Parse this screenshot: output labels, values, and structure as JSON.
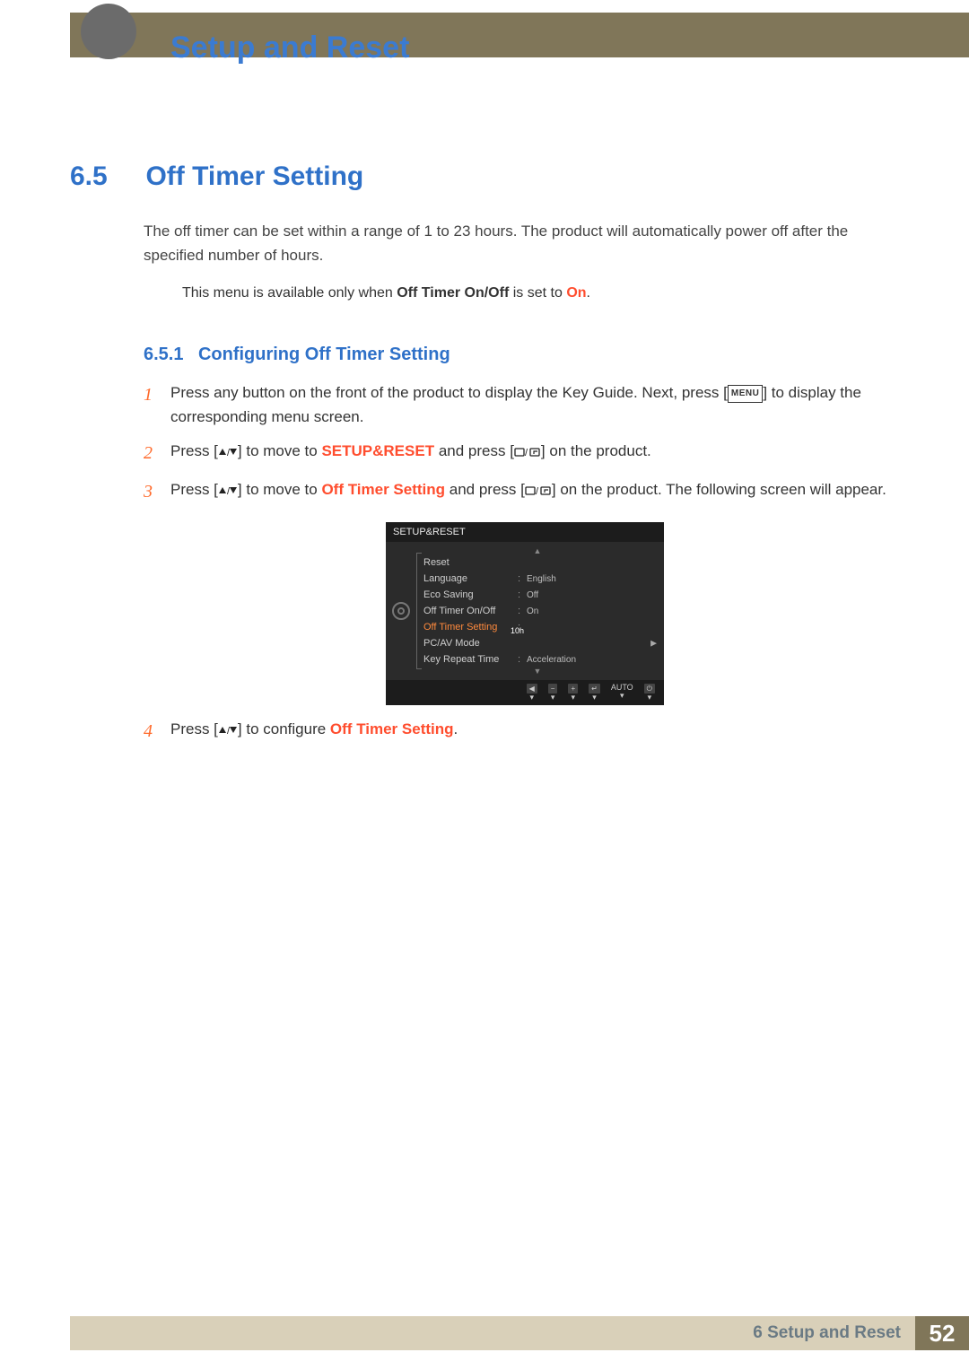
{
  "header": {
    "chapter_title": "Setup and Reset"
  },
  "section": {
    "number": "6.5",
    "title": "Off Timer Setting",
    "body": "The off timer can be set within a range of 1 to 23 hours. The product will automatically power off after the specified number of hours.",
    "note_prefix": "This menu is available only when ",
    "note_bold": "Off Timer On/Off",
    "note_mid": " is set to ",
    "note_on": "On",
    "note_suffix": "."
  },
  "subsection": {
    "number": "6.5.1",
    "title": "Configuring Off Timer Setting"
  },
  "steps": {
    "s1": {
      "num": "1",
      "a": "Press any button on the front of the product to display the Key Guide. Next, press [",
      "menu": "MENU",
      "b": "] to display the corresponding menu screen."
    },
    "s2": {
      "num": "2",
      "a": "Press [",
      "b": "] to move to ",
      "hl": "SETUP&RESET",
      "c": " and press [",
      "d": "] on the product."
    },
    "s3": {
      "num": "3",
      "a": "Press [",
      "b": "] to move to ",
      "hl": "Off Timer Setting",
      "c": " and press [",
      "d": "] on the product. The following screen will appear."
    },
    "s4": {
      "num": "4",
      "a": "Press [",
      "b": "] to configure ",
      "hl": "Off Timer Setting",
      "c": "."
    }
  },
  "osd": {
    "title": "SETUP&RESET",
    "rows": {
      "reset": "Reset",
      "language": "Language",
      "language_val": "English",
      "eco": "Eco Saving",
      "eco_val": "Off",
      "onoff": "Off Timer On/Off",
      "onoff_val": "On",
      "setting": "Off Timer Setting",
      "setting_val": "10h",
      "pcav": "PC/AV Mode",
      "repeat": "Key Repeat Time",
      "repeat_val": "Acceleration"
    },
    "footer": {
      "auto": "AUTO"
    }
  },
  "footer": {
    "chapter_ref": "6 Setup and Reset",
    "page": "52"
  },
  "chart_data": {
    "type": "table",
    "title": "SETUP&RESET on-screen menu",
    "rows": [
      {
        "label": "Reset",
        "value": ""
      },
      {
        "label": "Language",
        "value": "English"
      },
      {
        "label": "Eco Saving",
        "value": "Off"
      },
      {
        "label": "Off Timer On/Off",
        "value": "On"
      },
      {
        "label": "Off Timer Setting",
        "value": "10h",
        "selected": true
      },
      {
        "label": "PC/AV Mode",
        "value": ""
      },
      {
        "label": "Key Repeat Time",
        "value": "Acceleration"
      }
    ]
  }
}
